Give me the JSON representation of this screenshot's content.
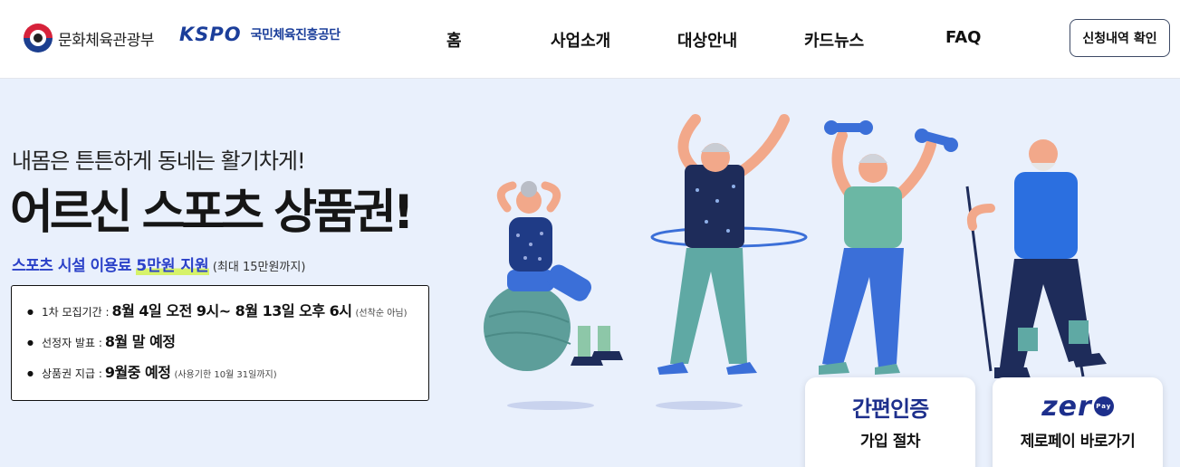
{
  "header": {
    "ministry_name": "문화체육관광부",
    "kspo_mark": "KSPO",
    "kspo_name": "국민체육진흥공단",
    "nav": [
      {
        "label": "홈"
      },
      {
        "label": "사업소개"
      },
      {
        "label": "대상안내"
      },
      {
        "label": "카드뉴스"
      },
      {
        "label": "FAQ"
      }
    ],
    "apply_check_label": "신청내역 확인"
  },
  "hero": {
    "subtitle": "내몸은 튼튼하게 동네는 활기차게!",
    "title": "어르신 스포츠 상품권!",
    "support_prefix": "스포츠 시설 이용료 ",
    "support_amount": "5만원 지원",
    "support_note": " (최대 15만원까지)",
    "info": [
      {
        "label": "1차 모집기간 :",
        "value": "8월 4일 오전 9시~ 8월 13일 오후 6시",
        "note": "(선착순 아님)"
      },
      {
        "label": "선정자 발표 :",
        "value": "8월 말 예정",
        "note": ""
      },
      {
        "label": "상품권 지급 :",
        "value": "9월중 예정",
        "note": "(사용기한 10월 31일까지)"
      }
    ]
  },
  "cards": {
    "auth": {
      "top": "간편인증",
      "label": "가입 절차"
    },
    "zeropay": {
      "logo_text": "zer",
      "pay_badge": "Pay",
      "label": "제로페이 바로가기"
    }
  },
  "colors": {
    "accent_blue": "#2b41c8",
    "navy": "#1d2f8c",
    "highlight_lime": "#d6f26a",
    "hero_bg": "#e9f0fc"
  },
  "icons": [
    "taeguk-logo-icon",
    "kspo-logo-icon",
    "zeropay-logo-icon"
  ]
}
